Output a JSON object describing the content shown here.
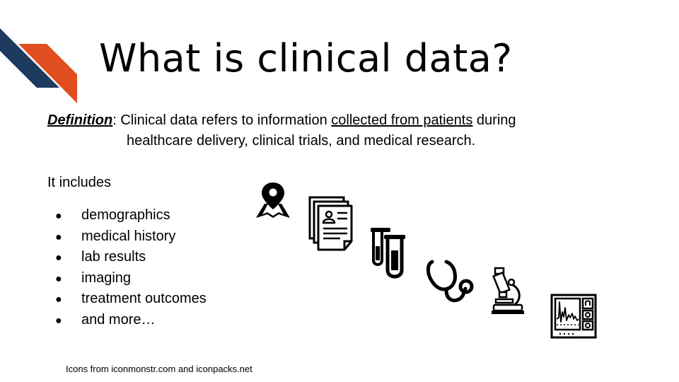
{
  "slide": {
    "title": "What is clinical data?",
    "definition": {
      "term": "Definition",
      "colon": ": ",
      "text_before": "Clinical data refers to information ",
      "underlined": "collected from patients",
      "text_after": " during",
      "line2": "healthcare delivery, clinical trials, and medical research."
    },
    "intro": "It includes",
    "bullet_symbol": "●",
    "items": [
      "demographics",
      "medical history",
      "lab results",
      "imaging",
      "treatment outcomes",
      "and more…"
    ],
    "credit": "Icons from iconmonstr.com and iconpacks.net",
    "icons": [
      "map-pin-icon",
      "documents-icon",
      "test-tubes-icon",
      "stethoscope-icon",
      "microscope-icon",
      "monitor-icon"
    ],
    "colors": {
      "accent_navy": "#1f3a5f",
      "accent_orange": "#e04e1f"
    }
  }
}
